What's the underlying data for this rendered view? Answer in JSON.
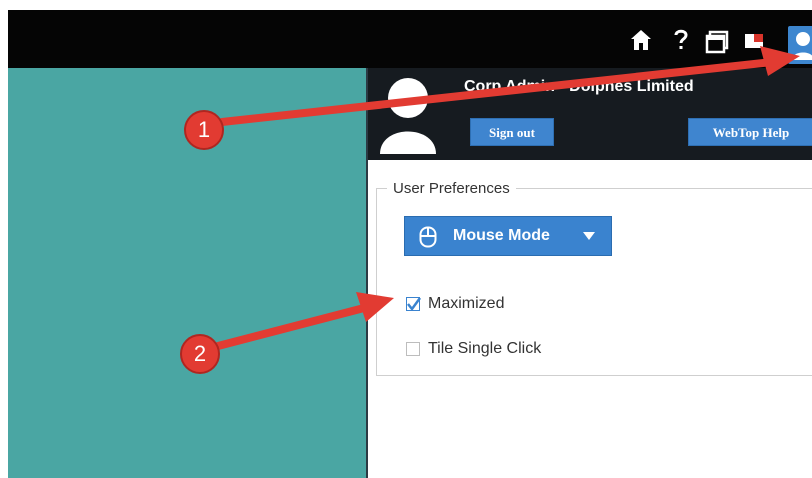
{
  "topbar": {
    "icons": [
      "home-icon",
      "help-icon",
      "windows-icon",
      "flag-icon",
      "user-icon"
    ]
  },
  "user_panel": {
    "user_name": "Corp Admin - Dolphes Limited",
    "sign_out_label": "Sign out",
    "help_label": "WebTop Help"
  },
  "preferences": {
    "legend": "User Preferences",
    "mouse_mode": {
      "label": "Mouse Mode",
      "icon": "mouse-icon"
    },
    "options": [
      {
        "label": "Maximized",
        "checked": true
      },
      {
        "label": "Tile Single Click",
        "checked": false
      }
    ]
  },
  "annotations": {
    "badge_1": "1",
    "badge_2": "2"
  },
  "colors": {
    "accent_blue": "#3a83cf",
    "teal_background": "#4aa6a3",
    "topbar": "#050505",
    "panel_header": "#161b20",
    "annotation_red": "#e23b32"
  }
}
